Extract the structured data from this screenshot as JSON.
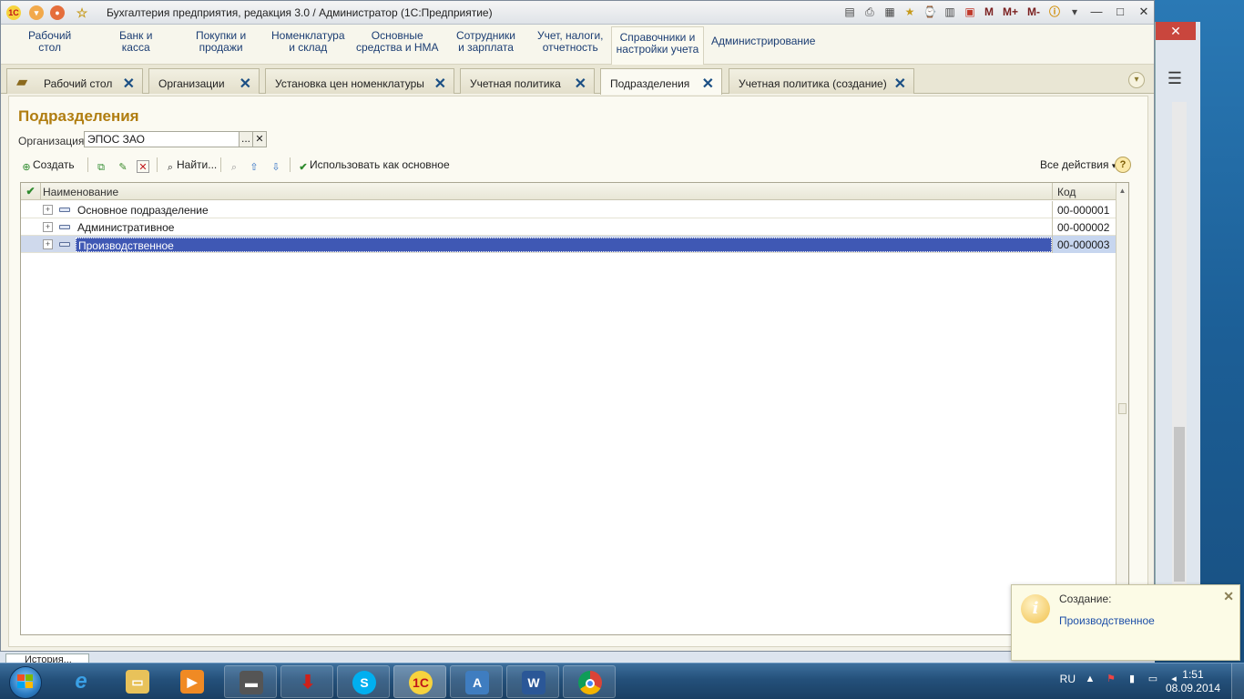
{
  "window": {
    "title": "Бухгалтерия предприятия, редакция 3.0 / Администратор  (1С:Предприятие)",
    "toolbar_marks": [
      "M",
      "M+",
      "M-"
    ]
  },
  "sections": [
    {
      "line1": "Рабочий",
      "line2": "стол"
    },
    {
      "line1": "Банк и",
      "line2": "касса"
    },
    {
      "line1": "Покупки и",
      "line2": "продажи"
    },
    {
      "line1": "Номенклатура",
      "line2": "и склад"
    },
    {
      "line1": "Основные",
      "line2": "средства и НМА"
    },
    {
      "line1": "Сотрудники",
      "line2": "и зарплата"
    },
    {
      "line1": "Учет, налоги,",
      "line2": "отчетность"
    },
    {
      "line1": "Справочники и",
      "line2": "настройки учета"
    },
    {
      "line1": "Администрирование",
      "line2": ""
    }
  ],
  "tabs": [
    {
      "label": "Рабочий стол"
    },
    {
      "label": "Организации"
    },
    {
      "label": "Установка цен номенклатуры"
    },
    {
      "label": "Учетная политика"
    },
    {
      "label": "Подразделения"
    },
    {
      "label": "Учетная политика (создание)"
    }
  ],
  "form": {
    "title": "Подразделения",
    "org_label": "Организация:",
    "org_value": "ЭПОС ЗАО",
    "org_select_label": "..."
  },
  "toolbar": {
    "create": "Создать",
    "find": "Найти...",
    "use_as_main": "Использовать как основное",
    "all_actions": "Все действия"
  },
  "table": {
    "col_name": "Наименование",
    "col_code": "Код",
    "rows": [
      {
        "name": "Основное подразделение",
        "code": "00-000001"
      },
      {
        "name": "Административное",
        "code": "00-000002"
      },
      {
        "name": "Производственное",
        "code": "00-000003"
      }
    ],
    "selected_row": 2
  },
  "history_tab": "История...",
  "notification": {
    "title": "Создание:",
    "link": "Производственное"
  },
  "tray": {
    "lang": "RU",
    "time": "1:51",
    "date": "08.09.2014"
  },
  "colors": {
    "title_accent": "#b07d10",
    "selection": "#3f58b4",
    "link": "#1d4fa8"
  }
}
